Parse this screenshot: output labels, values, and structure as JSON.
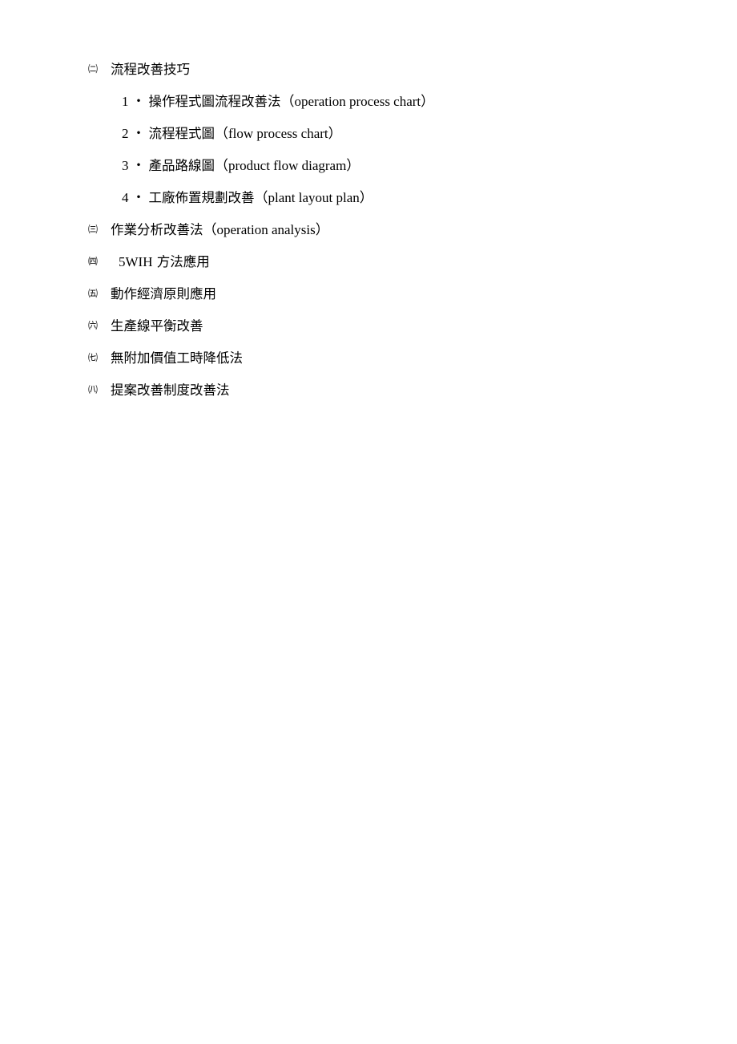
{
  "document": {
    "sections": [
      {
        "marker": "㈡",
        "title": "流程改善技巧",
        "subitems": [
          {
            "number": "1",
            "separator": "・",
            "title": "操作程式圖流程改善法",
            "english": "（operation process chart）"
          },
          {
            "number": "2",
            "separator": "・",
            "title": "流程程式圖",
            "english": "（flow process chart）"
          },
          {
            "number": "3",
            "separator": "・",
            "title": "產品路線圖",
            "english": "（product flow diagram）"
          },
          {
            "number": "4",
            "separator": "・",
            "title": "工廠佈置規劃改善",
            "english": "（plant layout plan）"
          }
        ]
      },
      {
        "marker": "㈢",
        "title": "作業分析改善法",
        "english": "（operation analysis）"
      },
      {
        "marker": "㈣",
        "prefix": "5WIH",
        "title": " 方法應用"
      },
      {
        "marker": "㈤",
        "title": "動作經濟原則應用"
      },
      {
        "marker": "㈥",
        "title": "生產線平衡改善"
      },
      {
        "marker": "㈦",
        "title": "無附加價值工時降低法"
      },
      {
        "marker": "㈧",
        "title": "提案改善制度改善法"
      }
    ]
  }
}
